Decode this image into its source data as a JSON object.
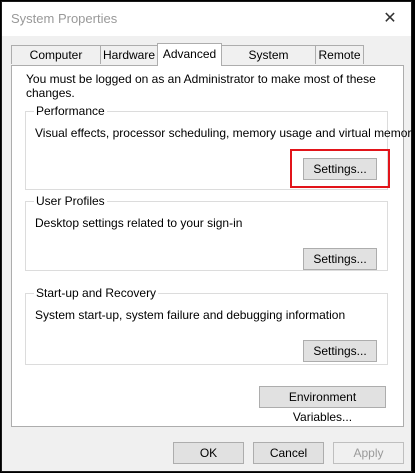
{
  "window": {
    "title": "System Properties",
    "close_glyph": "✕"
  },
  "tabs": [
    {
      "label": "Computer Name"
    },
    {
      "label": "Hardware"
    },
    {
      "label": "Advanced",
      "active": true
    },
    {
      "label": "System Protection"
    },
    {
      "label": "Remote"
    }
  ],
  "intro": "You must be logged on as an Administrator to make most of these changes.",
  "performance": {
    "title": "Performance",
    "description": "Visual effects, processor scheduling, memory usage and virtual memory",
    "button": "Settings..."
  },
  "user_profiles": {
    "title": "User Profiles",
    "description": "Desktop settings related to your sign-in",
    "button": "Settings..."
  },
  "startup_recovery": {
    "title": "Start-up and Recovery",
    "description": "System start-up, system failure and debugging information",
    "button": "Settings..."
  },
  "env_button": "Environment Variables...",
  "footer": {
    "ok": "OK",
    "cancel": "Cancel",
    "apply": "Apply"
  },
  "colors": {
    "highlight": "#e2141a"
  }
}
